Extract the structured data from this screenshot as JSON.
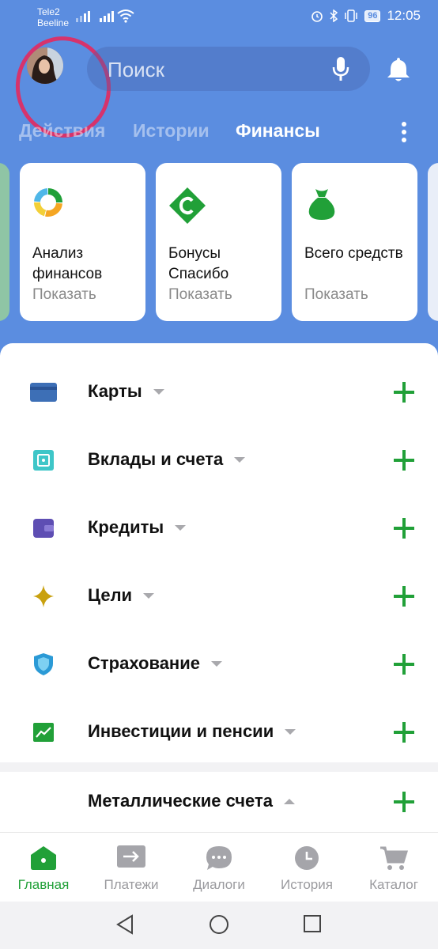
{
  "status_bar": {
    "carrier_1": "Tele2",
    "carrier_2": "Beeline",
    "battery": "96",
    "time": "12:05"
  },
  "header": {
    "search_placeholder": "Поиск",
    "icons": [
      "avatar",
      "mic-icon",
      "bell-icon"
    ]
  },
  "tabs": [
    {
      "label": "Действия",
      "active": false
    },
    {
      "label": "Истории",
      "active": false
    },
    {
      "label": "Финансы",
      "active": true
    }
  ],
  "cards": [
    {
      "title": "Анализ финансов",
      "subtitle": "Показать",
      "icon": "pie-chart-icon"
    },
    {
      "title": "Бонусы Спасибо",
      "subtitle": "Показать",
      "icon": "spasibo-icon"
    },
    {
      "title": "Всего средств",
      "subtitle": "Показать",
      "icon": "money-bag-icon"
    }
  ],
  "products": [
    {
      "label": "Карты",
      "icon": "card-icon",
      "expanded": false
    },
    {
      "label": "Вклады и счета",
      "icon": "safe-icon",
      "expanded": false
    },
    {
      "label": "Кредиты",
      "icon": "wallet-icon",
      "expanded": false
    },
    {
      "label": "Цели",
      "icon": "star-icon",
      "expanded": false
    },
    {
      "label": "Страхование",
      "icon": "shield-icon",
      "expanded": false
    },
    {
      "label": "Инвестиции и пенсии",
      "icon": "chart-icon",
      "expanded": false
    },
    {
      "label": "Металлические счета",
      "icon": "",
      "expanded": true
    }
  ],
  "bottom_nav": [
    {
      "label": "Главная",
      "icon": "home-icon",
      "active": true
    },
    {
      "label": "Платежи",
      "icon": "payments-icon",
      "active": false
    },
    {
      "label": "Диалоги",
      "icon": "chat-icon",
      "active": false
    },
    {
      "label": "История",
      "icon": "clock-icon",
      "active": false
    },
    {
      "label": "Каталог",
      "icon": "cart-icon",
      "active": false
    }
  ],
  "colors": {
    "header_bg": "#5b8de0",
    "accent_green": "#21a038",
    "annotation_circle": "#d6336c"
  }
}
